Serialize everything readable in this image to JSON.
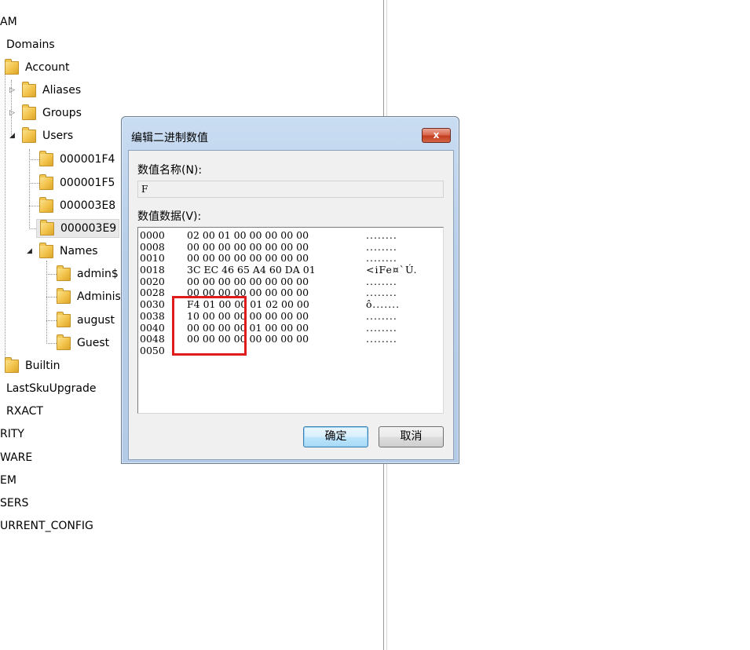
{
  "tree": {
    "items": [
      {
        "label": "AM"
      },
      {
        "label": "Domains"
      },
      {
        "label": "Account"
      },
      {
        "label": "Aliases"
      },
      {
        "label": "Groups"
      },
      {
        "label": "Users"
      },
      {
        "label": "000001F4"
      },
      {
        "label": "000001F5"
      },
      {
        "label": "000003E8"
      },
      {
        "label": "000003E9"
      },
      {
        "label": "Names"
      },
      {
        "label": "admin$"
      },
      {
        "label": "Administr"
      },
      {
        "label": "august"
      },
      {
        "label": "Guest"
      },
      {
        "label": "Builtin"
      },
      {
        "label": "LastSkuUpgrade"
      },
      {
        "label": "RXACT"
      },
      {
        "label": "RITY"
      },
      {
        "label": "WARE"
      },
      {
        "label": "EM"
      },
      {
        "label": "SERS"
      },
      {
        "label": "URRENT_CONFIG"
      }
    ],
    "selected": "000003E9",
    "icons": {
      "folder": "folder-icon",
      "collapsed": "triangle-right-icon",
      "expanded": "triangle-down-icon"
    }
  },
  "dialog": {
    "title": "编辑二进制数值",
    "close_label": "x",
    "value_name_label": "数值名称(N):",
    "value_name": "F",
    "value_data_label": "数值数据(V):",
    "hex_rows": [
      {
        "offset": "0000",
        "bytes": "02 00 01 00 00 00 00 00",
        "ascii": "........"
      },
      {
        "offset": "0008",
        "bytes": "00 00 00 00 00 00 00 00",
        "ascii": "........"
      },
      {
        "offset": "0010",
        "bytes": "00 00 00 00 00 00 00 00",
        "ascii": "........"
      },
      {
        "offset": "0018",
        "bytes": "3C EC 46 65 A4 60 DA 01",
        "ascii": "<iFe¤`Ú."
      },
      {
        "offset": "0020",
        "bytes": "00 00 00 00 00 00 00 00",
        "ascii": "........"
      },
      {
        "offset": "0028",
        "bytes": "00 00 00 00 00 00 00 00",
        "ascii": "........"
      },
      {
        "offset": "0030",
        "bytes": "F4 01 00 00 01 02 00 00",
        "ascii": "ô......."
      },
      {
        "offset": "0038",
        "bytes": "10 00 00 00 00 00 00 00",
        "ascii": "........"
      },
      {
        "offset": "0040",
        "bytes": "00 00 00 00 01 00 00 00",
        "ascii": "........"
      },
      {
        "offset": "0048",
        "bytes": "00 00 00 00 00 00 00 00",
        "ascii": "........"
      },
      {
        "offset": "0050",
        "bytes": "",
        "ascii": ""
      }
    ],
    "ok_label": "确定",
    "cancel_label": "取消"
  },
  "colors": {
    "highlight_box": "#e01b1b",
    "dialog_frame": "#b7cee9",
    "close_button": "#c43d1f"
  }
}
